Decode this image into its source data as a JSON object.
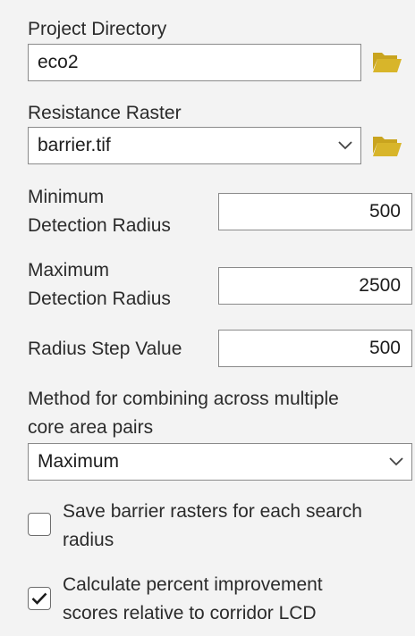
{
  "project_directory": {
    "label": "Project Directory",
    "value": "eco2",
    "browse_icon": "folder-open-icon"
  },
  "resistance_raster": {
    "label": "Resistance Raster",
    "value": "barrier.tif",
    "browse_icon": "folder-open-icon"
  },
  "min_radius": {
    "label_line1": "Minimum",
    "label_line2": "Detection Radius",
    "value": "500"
  },
  "max_radius": {
    "label_line1": "Maximum",
    "label_line2": "Detection Radius",
    "value": "2500"
  },
  "radius_step": {
    "label": "Radius Step Value",
    "value": "500"
  },
  "combine_method": {
    "label_line1": "Method for combining across multiple",
    "label_line2": "core area pairs",
    "value": "Maximum"
  },
  "save_barrier": {
    "label_line1": "Save barrier rasters for each search",
    "label_line2": "radius",
    "checked": false
  },
  "calc_percent": {
    "label_line1": "Calculate percent improvement",
    "label_line2": "scores relative to corridor LCD",
    "checked": true
  },
  "colors": {
    "folder": "#d8b52a",
    "background": "#f3f3f3",
    "border": "#8a8a8a"
  }
}
